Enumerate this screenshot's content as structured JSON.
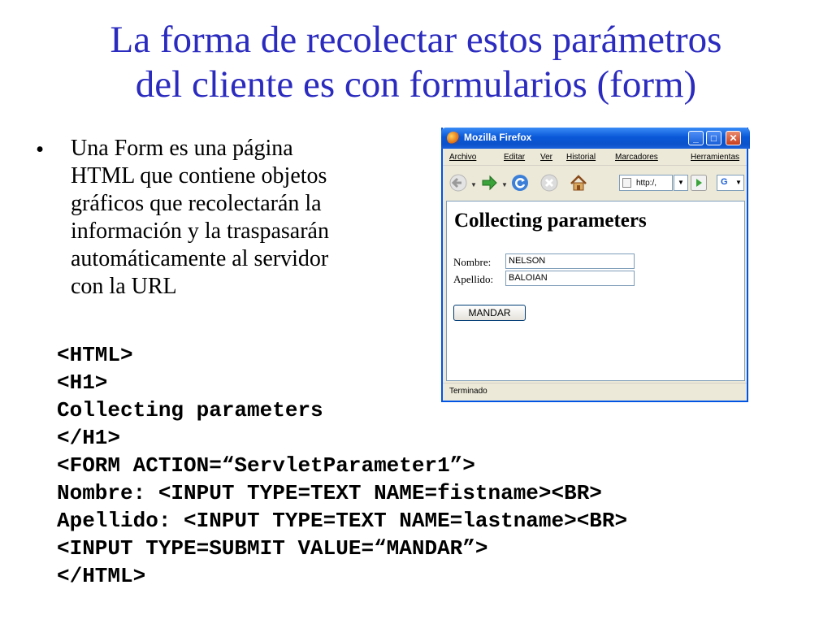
{
  "slide": {
    "title_line1": "La forma de recolectar estos parámetros",
    "title_line2": "del cliente es con formularios (form)",
    "bullet_char": "•",
    "bullet_lines": [
      "Una Form es una página",
      "HTML que contiene objetos",
      "gráficos que recolectarán la",
      "información y la traspasarán",
      "automáticamente al servidor",
      "con la URL"
    ],
    "code_lines": [
      "<HTML>",
      "<H1>",
      "Collecting parameters",
      "</H1>",
      "<FORM ACTION=“ServletParameter1”>",
      "Nombre: <INPUT TYPE=TEXT NAME=fistname><BR>",
      "Apellido: <INPUT TYPE=TEXT NAME=lastname><BR>",
      "<INPUT TYPE=SUBMIT VALUE=“MANDAR”>",
      "</HTML>"
    ]
  },
  "browser": {
    "title": "Mozilla Firefox",
    "window_buttons": {
      "minimize": "_",
      "maximize": "□",
      "close": "✕"
    },
    "menu": [
      "Archivo",
      "Editar",
      "Ver",
      "Historial",
      "Marcadores",
      "Herramientas"
    ],
    "url": "http:/,",
    "search_engine": "G",
    "page": {
      "heading": "Collecting parameters",
      "nombre_label": "Nombre:",
      "nombre_value": "NELSON",
      "apellido_label": "Apellido:",
      "apellido_value": "BALOIAN",
      "submit_label": "MANDAR"
    },
    "status": "Terminado"
  },
  "colors": {
    "title": "#2b2bbf",
    "titlebar": "#0a58d8",
    "window_chrome": "#ece9d8"
  }
}
